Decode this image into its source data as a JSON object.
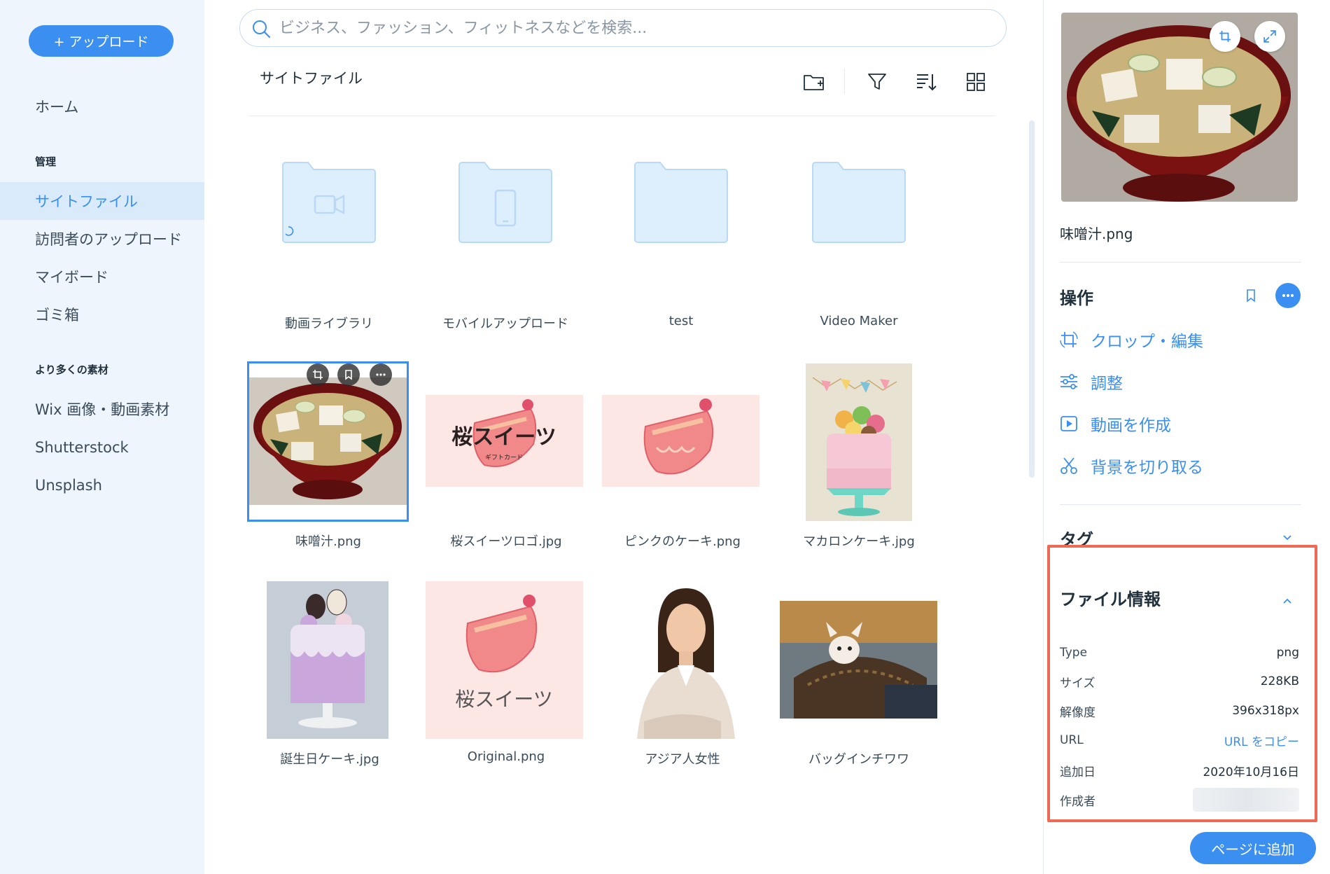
{
  "sidebar": {
    "upload_label": "+ アップロード",
    "home_label": "ホーム",
    "section_manage": "管理",
    "items": [
      {
        "label": "サイトファイル",
        "active": true
      },
      {
        "label": "訪問者のアップロード"
      },
      {
        "label": "マイボード"
      },
      {
        "label": "ゴミ箱"
      }
    ],
    "section_more": "より多くの素材",
    "more_items": [
      {
        "label": "Wix 画像・動画素材"
      },
      {
        "label": "Shutterstock"
      },
      {
        "label": "Unsplash"
      }
    ]
  },
  "search": {
    "placeholder": "ビジネス、ファッション、フィットネスなどを検索..."
  },
  "main": {
    "title": "サイトファイル",
    "toolbar": [
      "new-folder-icon",
      "filter-icon",
      "sort-icon",
      "grid-view-icon"
    ],
    "folders": [
      {
        "label": "動画ライブラリ",
        "icon": "video-icon"
      },
      {
        "label": "モバイルアップロード",
        "icon": "phone-icon"
      },
      {
        "label": "test"
      },
      {
        "label": "Video Maker"
      }
    ],
    "files": [
      {
        "label": "味噌汁.png",
        "selected": true
      },
      {
        "label": "桜スイーツロゴ.jpg",
        "logo_text": "桜スイーツ",
        "logo_sub": "ギフトカード"
      },
      {
        "label": "ピンクのケーキ.png"
      },
      {
        "label": "マカロンケーキ.jpg"
      },
      {
        "label": "誕生日ケーキ.jpg"
      },
      {
        "label": "Original.png",
        "logo_text": "桜スイーツ"
      },
      {
        "label": "アジア人女性"
      },
      {
        "label": "バッグインチワワ"
      }
    ]
  },
  "panel": {
    "file_name": "味噌汁.png",
    "actions_title": "操作",
    "actions": [
      {
        "label": "クロップ・編集",
        "icon": "crop-icon"
      },
      {
        "label": "調整",
        "icon": "sliders-icon"
      },
      {
        "label": "動画を作成",
        "icon": "play-icon"
      },
      {
        "label": "背景を切り取る",
        "icon": "scissors-icon"
      }
    ],
    "tags_title": "タグ",
    "info_title": "ファイル情報",
    "info": {
      "type_key": "Type",
      "type_val": "png",
      "size_key": "サイズ",
      "size_val": "228KB",
      "res_key": "解像度",
      "res_val": "396x318px",
      "url_key": "URL",
      "url_val": "URL をコピー",
      "date_key": "追加日",
      "date_val": "2020年10月16日",
      "author_key": "作成者"
    },
    "add_button": "ページに追加"
  },
  "colors": {
    "accent": "#3b8ff0",
    "sidebar_bg": "#eef5fc",
    "highlight": "#ef6a55",
    "folder": "#ddeefd"
  }
}
